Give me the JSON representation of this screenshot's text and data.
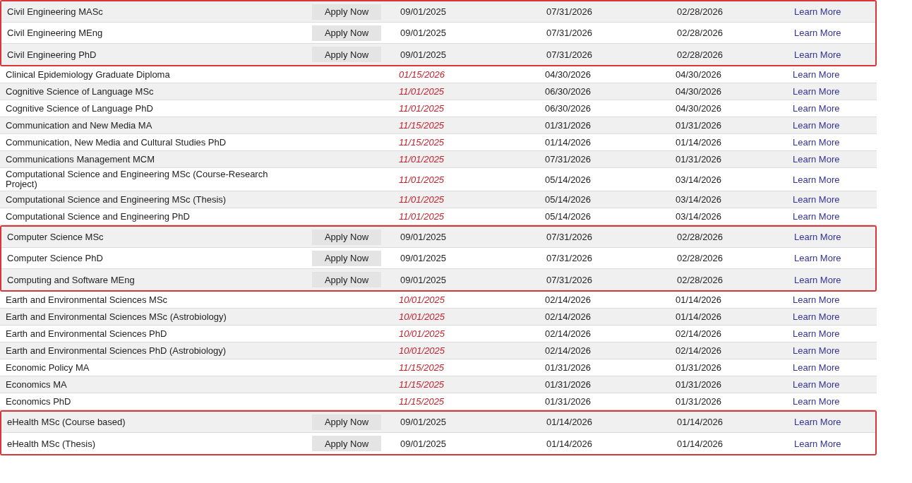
{
  "rows": [
    {
      "program": "Civil Engineering MASc",
      "open": true,
      "apply": "Apply Now",
      "dates": [
        "09/01/2025",
        "07/31/2026",
        "02/28/2026"
      ],
      "link": "Learn More"
    },
    {
      "program": "Civil Engineering MEng",
      "open": true,
      "apply": "Apply Now",
      "dates": [
        "09/01/2025",
        "07/31/2026",
        "02/28/2026"
      ],
      "link": "Learn More"
    },
    {
      "program": "Civil Engineering PhD",
      "open": true,
      "apply": "Apply Now",
      "dates": [
        "09/01/2025",
        "07/31/2026",
        "02/28/2026"
      ],
      "link": "Learn More"
    },
    {
      "program": "Clinical Epidemiology Graduate Diploma",
      "open": false,
      "dates": [
        "01/15/2026",
        "04/30/2026",
        "04/30/2026"
      ],
      "link": "Learn More"
    },
    {
      "program": "Cognitive Science of Language MSc",
      "open": false,
      "dates": [
        "11/01/2025",
        "06/30/2026",
        "04/30/2026"
      ],
      "link": "Learn More"
    },
    {
      "program": "Cognitive Science of Language PhD",
      "open": false,
      "dates": [
        "11/01/2025",
        "06/30/2026",
        "04/30/2026"
      ],
      "link": "Learn More"
    },
    {
      "program": "Communication and New Media MA",
      "open": false,
      "dates": [
        "11/15/2025",
        "01/31/2026",
        "01/31/2026"
      ],
      "link": "Learn More"
    },
    {
      "program": "Communication, New Media and Cultural Studies PhD",
      "open": false,
      "dates": [
        "11/15/2025",
        "01/14/2026",
        "01/14/2026"
      ],
      "link": "Learn More"
    },
    {
      "program": "Communications Management MCM",
      "open": false,
      "dates": [
        "11/01/2025",
        "07/31/2026",
        "01/31/2026"
      ],
      "link": "Learn More"
    },
    {
      "program": "Computational Science and Engineering MSc (Course-Research Project)",
      "open": false,
      "dates": [
        "11/01/2025",
        "05/14/2026",
        "03/14/2026"
      ],
      "link": "Learn More"
    },
    {
      "program": "Computational Science and Engineering MSc (Thesis)",
      "open": false,
      "dates": [
        "11/01/2025",
        "05/14/2026",
        "03/14/2026"
      ],
      "link": "Learn More"
    },
    {
      "program": "Computational Science and Engineering PhD",
      "open": false,
      "dates": [
        "11/01/2025",
        "05/14/2026",
        "03/14/2026"
      ],
      "link": "Learn More"
    },
    {
      "program": "Computer Science MSc",
      "open": true,
      "apply": "Apply Now",
      "dates": [
        "09/01/2025",
        "07/31/2026",
        "02/28/2026"
      ],
      "link": "Learn More"
    },
    {
      "program": "Computer Science PhD",
      "open": true,
      "apply": "Apply Now",
      "dates": [
        "09/01/2025",
        "07/31/2026",
        "02/28/2026"
      ],
      "link": "Learn More"
    },
    {
      "program": "Computing and Software MEng",
      "open": true,
      "apply": "Apply Now",
      "dates": [
        "09/01/2025",
        "07/31/2026",
        "02/28/2026"
      ],
      "link": "Learn More"
    },
    {
      "program": "Earth and Environmental Sciences MSc",
      "open": false,
      "dates": [
        "10/01/2025",
        "02/14/2026",
        "01/14/2026"
      ],
      "link": "Learn More"
    },
    {
      "program": "Earth and Environmental Sciences MSc (Astrobiology)",
      "open": false,
      "dates": [
        "10/01/2025",
        "02/14/2026",
        "01/14/2026"
      ],
      "link": "Learn More"
    },
    {
      "program": "Earth and Environmental Sciences PhD",
      "open": false,
      "dates": [
        "10/01/2025",
        "02/14/2026",
        "02/14/2026"
      ],
      "link": "Learn More"
    },
    {
      "program": "Earth and Environmental Sciences PhD (Astrobiology)",
      "open": false,
      "dates": [
        "10/01/2025",
        "02/14/2026",
        "02/14/2026"
      ],
      "link": "Learn More"
    },
    {
      "program": "Economic Policy MA",
      "open": false,
      "dates": [
        "11/15/2025",
        "01/31/2026",
        "01/31/2026"
      ],
      "link": "Learn More"
    },
    {
      "program": "Economics MA",
      "open": false,
      "dates": [
        "11/15/2025",
        "01/31/2026",
        "01/31/2026"
      ],
      "link": "Learn More"
    },
    {
      "program": "Economics PhD",
      "open": false,
      "dates": [
        "11/15/2025",
        "01/31/2026",
        "01/31/2026"
      ],
      "link": "Learn More"
    },
    {
      "program": "eHealth MSc (Course based)",
      "open": true,
      "apply": "Apply Now",
      "dates": [
        "09/01/2025",
        "01/14/2026",
        "01/14/2026"
      ],
      "link": "Learn More"
    },
    {
      "program": "eHealth MSc (Thesis)",
      "open": true,
      "apply": "Apply Now",
      "dates": [
        "09/01/2025",
        "01/14/2026",
        "01/14/2026"
      ],
      "link": "Learn More"
    }
  ]
}
